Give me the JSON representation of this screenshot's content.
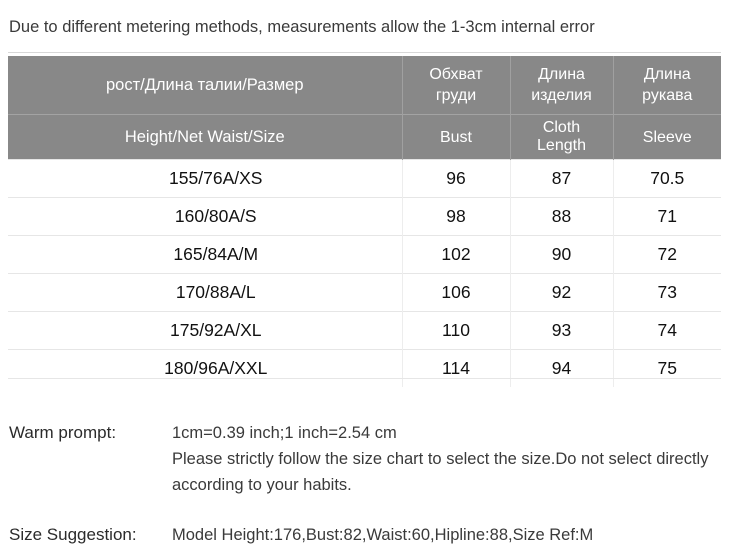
{
  "intro": {
    "text": "Due to different metering methods, measurements allow the 1-3cm internal error"
  },
  "table": {
    "headers_ru": {
      "size": "рост/Длина  талии/Размер",
      "bust": "Обхват\nгруди",
      "cloth_length": "Длина\nизделия",
      "sleeve": "Длина\nрукава"
    },
    "headers_en": {
      "size": "Height/Net  Waist/Size",
      "bust": "Bust",
      "cloth_length": "Cloth\nLength",
      "sleeve": "Sleeve"
    },
    "rows": [
      {
        "size": "155/76A/XS",
        "bust": "96",
        "cloth_length": "87",
        "sleeve": "70.5"
      },
      {
        "size": "160/80A/S",
        "bust": "98",
        "cloth_length": "88",
        "sleeve": "71"
      },
      {
        "size": "165/84A/M",
        "bust": "102",
        "cloth_length": "90",
        "sleeve": "72"
      },
      {
        "size": "170/88A/L",
        "bust": "106",
        "cloth_length": "92",
        "sleeve": "73"
      },
      {
        "size": "175/92A/XL",
        "bust": "110",
        "cloth_length": "93",
        "sleeve": "74"
      },
      {
        "size": "180/96A/XXL",
        "bust": "114",
        "cloth_length": "94",
        "sleeve": "75"
      }
    ]
  },
  "notes": {
    "warm_prompt_label": "Warm prompt:",
    "warm_prompt_line1": "1cm=0.39 inch;1 inch=2.54 cm",
    "warm_prompt_line2": "Please strictly follow the size chart  to select the size.Do not select directly according to your habits.",
    "size_suggestion_label": "Size Suggestion:",
    "size_suggestion_value": "Model Height:176,Bust:82,Waist:60,Hipline:88,Size Ref:M"
  },
  "colors": {
    "header_gray": "#888888",
    "header_text": "#ffffff",
    "body_text": "#111111",
    "rule": "#e6e6e6"
  }
}
